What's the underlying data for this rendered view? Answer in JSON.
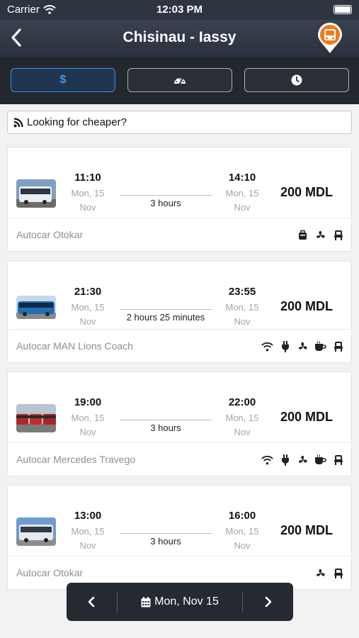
{
  "status_bar": {
    "carrier": "Carrier",
    "time": "12:03 PM"
  },
  "nav": {
    "title": "Chisinau - Iassy",
    "back_icon": "chevron-left-icon",
    "map_pin_icon": "bus-pin-icon"
  },
  "sort": {
    "price_symbol": "$",
    "active": "price",
    "options": [
      "price",
      "speed",
      "departure-time"
    ]
  },
  "cheaper": {
    "label": "Looking for cheaper?",
    "icon": "rss-icon"
  },
  "trips": [
    {
      "depart_time": "11:10",
      "depart_day": "Mon, 15",
      "depart_month": "Nov",
      "arrive_time": "14:10",
      "arrive_day": "Mon, 15",
      "arrive_month": "Nov",
      "duration": "3 hours",
      "price": "200 MDL",
      "operator": "Autocar Otokar",
      "amenities": [
        "luggage-icon",
        "ac-icon",
        "reclining-seat-icon"
      ]
    },
    {
      "depart_time": "21:30",
      "depart_day": "Mon, 15",
      "depart_month": "Nov",
      "arrive_time": "23:55",
      "arrive_day": "Mon, 15",
      "arrive_month": "Nov",
      "duration": "2 hours 25 minutes",
      "price": "200 MDL",
      "operator": "Autocar MAN Lions Coach",
      "amenities": [
        "wifi-icon",
        "power-plug-icon",
        "ac-icon",
        "coffee-icon",
        "reclining-seat-icon"
      ]
    },
    {
      "depart_time": "19:00",
      "depart_day": "Mon, 15",
      "depart_month": "Nov",
      "arrive_time": "22:00",
      "arrive_day": "Mon, 15",
      "arrive_month": "Nov",
      "duration": "3 hours",
      "price": "200 MDL",
      "operator": "Autocar Mercedes Travego",
      "amenities": [
        "wifi-icon",
        "power-plug-icon",
        "ac-icon",
        "coffee-icon",
        "reclining-seat-icon"
      ]
    },
    {
      "depart_time": "13:00",
      "depart_day": "Mon, 15",
      "depart_month": "Nov",
      "arrive_time": "16:00",
      "arrive_day": "Mon, 15",
      "arrive_month": "Nov",
      "duration": "3 hours",
      "price": "200 MDL",
      "operator": "Autocar Otokar",
      "amenities": [
        "ac-icon",
        "reclining-seat-icon"
      ]
    }
  ],
  "pager": {
    "date": "Mon, Nov 15",
    "prev_icon": "chevron-left-icon",
    "next_icon": "chevron-right-icon",
    "calendar_icon": "calendar-icon"
  },
  "colors": {
    "accent": "#3d9bf0",
    "header": "#2f3540",
    "pin": "#f07a1a"
  }
}
